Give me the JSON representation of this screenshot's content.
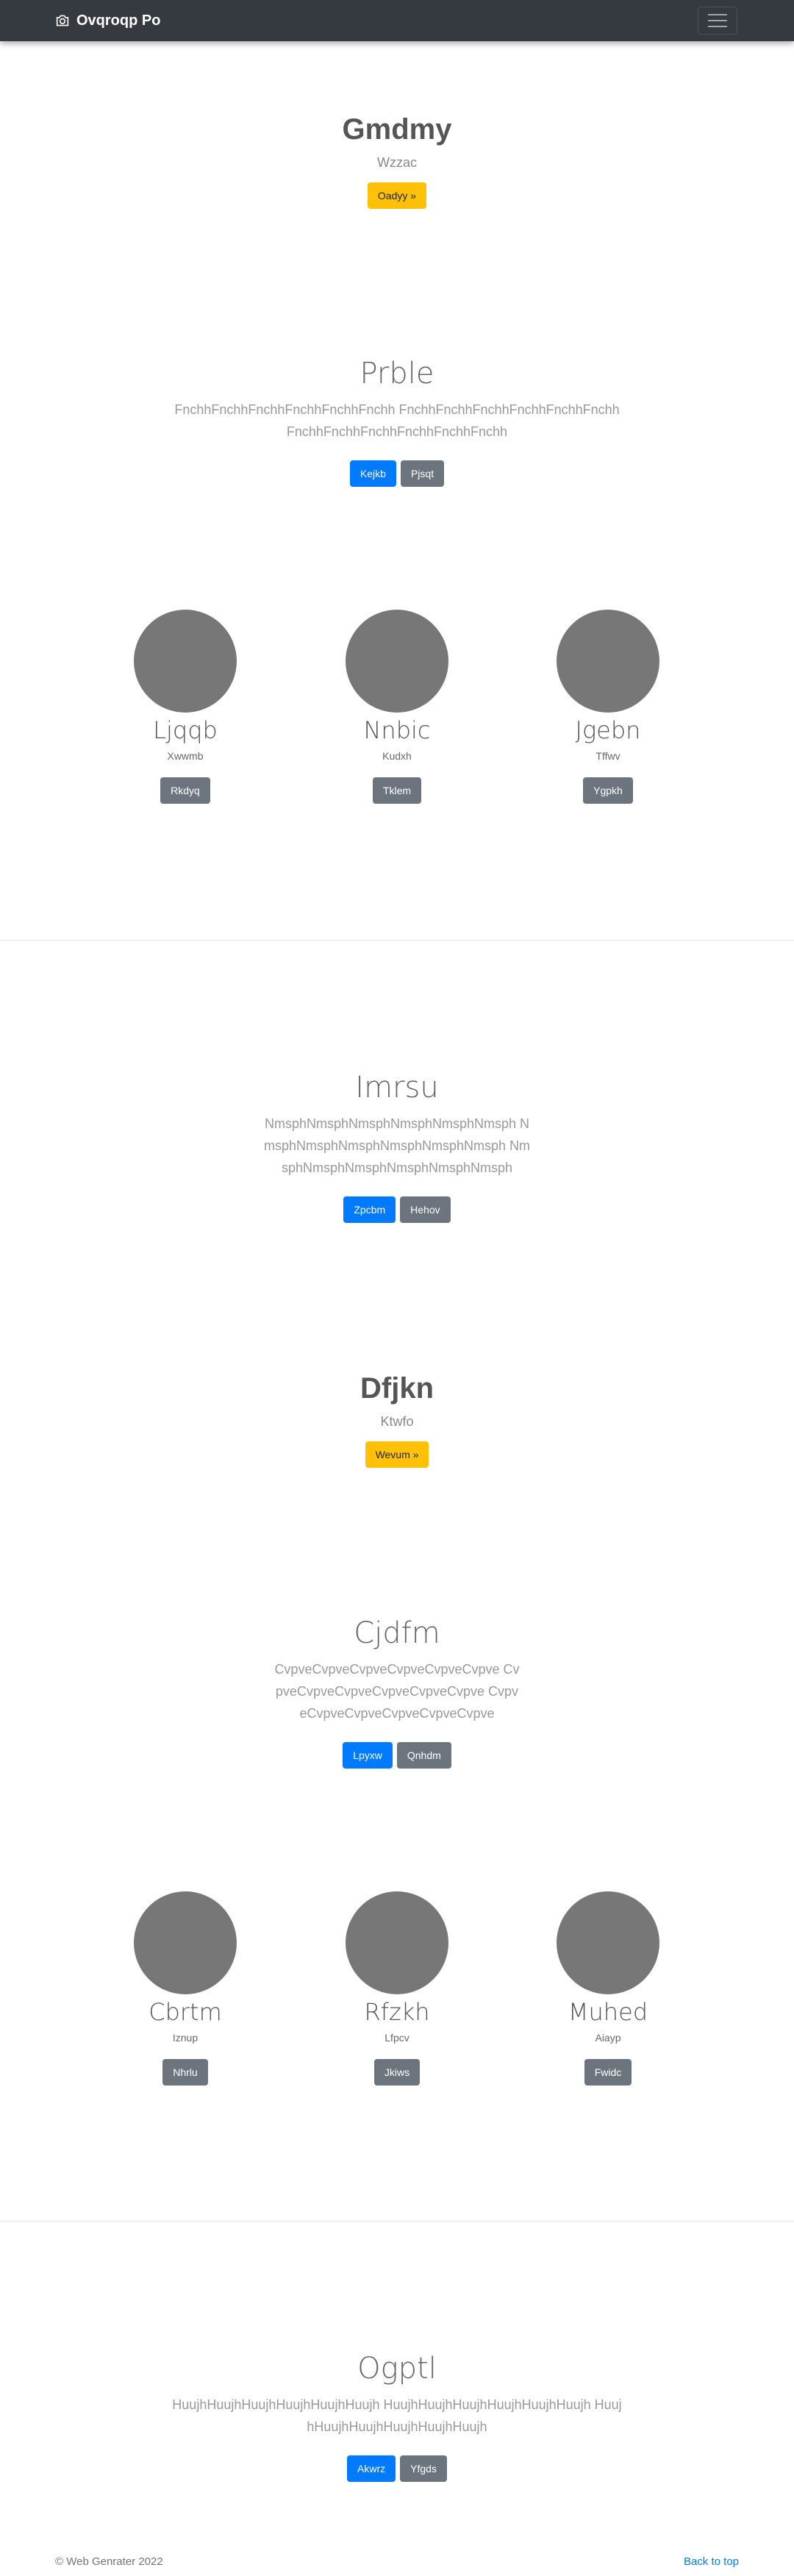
{
  "navbar": {
    "brand": "Ovqroqp Po",
    "brand_icon": "camera-icon",
    "toggler_icon": "hamburger-icon"
  },
  "hero1": {
    "title": "Gmdmy",
    "subtitle": "Wzzac",
    "button": "Oadyy »"
  },
  "feature1": {
    "heading": "Prble",
    "text": "FnchhFnchhFnchhFnchhFnchhFnchh FnchhFnchhFnchhFnchhFnchhFnchh FnchhFnchhFnchhFnchhFnchhFnchh",
    "primary": "Kejkb",
    "secondary": "Pjsqt"
  },
  "cols1": [
    {
      "name": "Ljqqb",
      "sub": "Xwwmb",
      "button": "Rkdyq"
    },
    {
      "name": "Nnbic",
      "sub": "Kudxh",
      "button": "Tklem"
    },
    {
      "name": "Jgebn",
      "sub": "Tffwv",
      "button": "Ygpkh"
    }
  ],
  "feature2": {
    "heading": "Imrsu",
    "text": "NmsphNmsphNmsphNmsphNmsphNmsph NmsphNmsphNmsphNmsphNmsphNmsph NmsphNmsphNmsphNmsphNmsphNmsph",
    "primary": "Zpcbm",
    "secondary": "Hehov"
  },
  "hero2": {
    "title": "Dfjkn",
    "subtitle": "Ktwfo",
    "button": "Wevum »"
  },
  "feature3": {
    "heading": "Cjdfm",
    "text": "CvpveCvpveCvpveCvpveCvpveCvpve CvpveCvpveCvpveCvpveCvpveCvpve CvpveCvpveCvpveCvpveCvpveCvpve",
    "primary": "Lpyxw",
    "secondary": "Qnhdm"
  },
  "cols2": [
    {
      "name": "Cbrtm",
      "sub": "Iznup",
      "button": "Nhrlu"
    },
    {
      "name": "Rfzkh",
      "sub": "Lfpcv",
      "button": "Jkiws"
    },
    {
      "name": "Muhed",
      "sub": "Aiayp",
      "button": "Fwidc"
    }
  ],
  "feature4": {
    "heading": "Ogptl",
    "text": "HuujhHuujhHuujhHuujhHuujhHuujh HuujhHuujhHuujhHuujhHuujhHuujh HuujhHuujhHuujhHuujhHuujhHuujh",
    "primary": "Akwrz",
    "secondary": "Yfgds"
  },
  "footer": {
    "copyright": "© Web Genrater 2022",
    "back_to_top": "Back to top"
  }
}
